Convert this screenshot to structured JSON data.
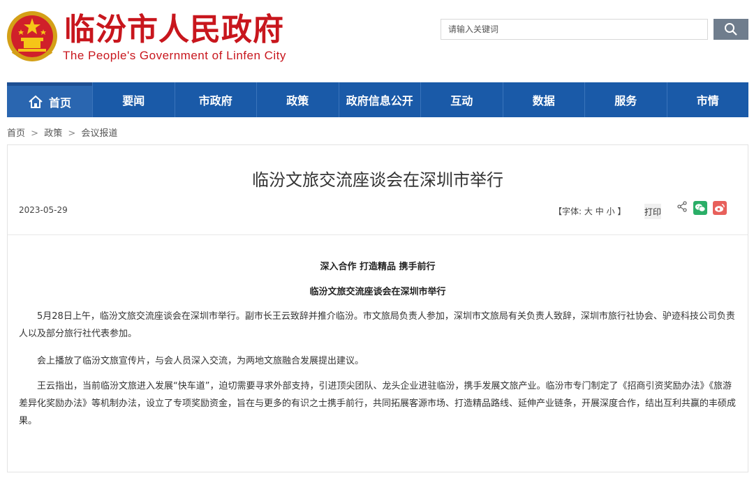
{
  "header": {
    "site_title": "临汾市人民政府",
    "site_subtitle": "The People's Government of Linfen City",
    "emblem_icon": "national-emblem-icon",
    "brand_color": "#c8161d"
  },
  "search": {
    "placeholder": "请输入关键词",
    "button_icon": "search-icon"
  },
  "nav": {
    "items": [
      {
        "label": "首页",
        "icon": "home-icon"
      },
      {
        "label": "要闻"
      },
      {
        "label": "市政府"
      },
      {
        "label": "政策"
      },
      {
        "label": "政府信息公开"
      },
      {
        "label": "互动"
      },
      {
        "label": "数据"
      },
      {
        "label": "服务"
      },
      {
        "label": "市情"
      }
    ],
    "color": "#1a5aa8"
  },
  "breadcrumb": {
    "items": [
      "首页",
      "政策",
      "会议报道"
    ],
    "separator": ">"
  },
  "article": {
    "title": "临汾文旅交流座谈会在深圳市举行",
    "date": "2023-05-29",
    "font_size_label_open": "【字体:",
    "font_large": "大",
    "font_medium": "中",
    "font_small": "小",
    "font_size_label_close": "】",
    "print_label": "打印",
    "subhead_1": "深入合作 打造精品 携手前行",
    "subhead_2": "临汾文旅交流座谈会在深圳市举行",
    "paragraphs": [
      "5月28日上午，临汾文旅交流座谈会在深圳市举行。副市长王云致辞并推介临汾。市文旅局负责人参加，深圳市文旅局有关负责人致辞，深圳市旅行社协会、驴迹科技公司负责人以及部分旅行社代表参加。",
      "会上播放了临汾文旅宣传片，与会人员深入交流，为两地文旅融合发展提出建议。",
      "王云指出，当前临汾文旅进入发展“快车道”，迫切需要寻求外部支持，引进顶尖团队、龙头企业进驻临汾，携手发展文旅产业。临汾市专门制定了《招商引资奖励办法》《旅游差异化奖励办法》等机制办法，设立了专项奖励资金，旨在与更多的有识之士携手前行，共同拓展客源市场、打造精品路线、延伸产业链条，开展深度合作，结出互利共赢的丰硕成果。"
    ]
  }
}
